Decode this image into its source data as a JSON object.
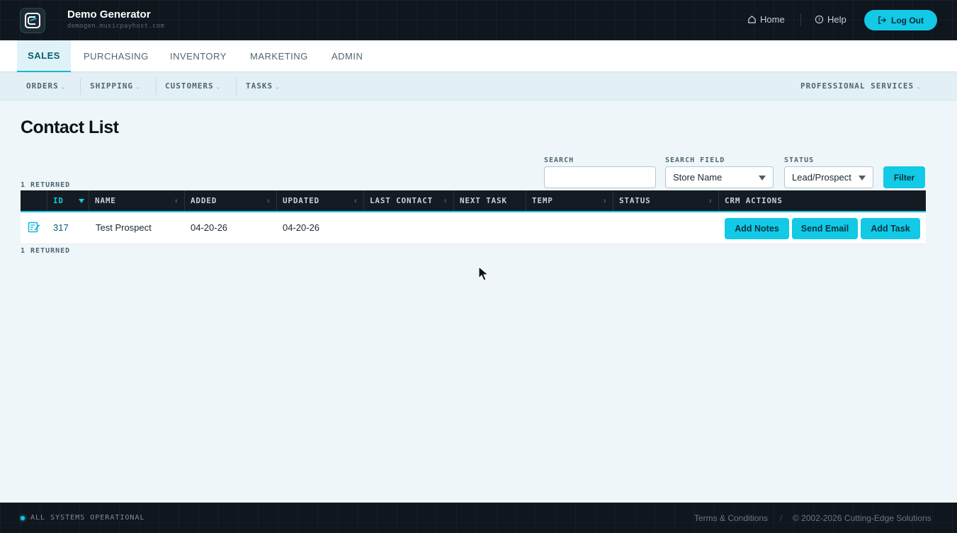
{
  "header": {
    "brand_name": "Demo Generator",
    "brand_host": "demogen.musicpayhost.com",
    "home_label": "Home",
    "help_label": "Help",
    "logout_label": "Log Out"
  },
  "tabs": [
    {
      "label": "SALES",
      "active": true
    },
    {
      "label": "PURCHASING",
      "active": false
    },
    {
      "label": "INVENTORY",
      "active": false
    },
    {
      "label": "MARKETING",
      "active": false
    },
    {
      "label": "ADMIN",
      "active": false
    }
  ],
  "subnav": {
    "items": [
      {
        "label": "ORDERS"
      },
      {
        "label": "SHIPPING"
      },
      {
        "label": "CUSTOMERS"
      },
      {
        "label": "TASKS"
      }
    ],
    "right_item": "PROFESSIONAL SERVICES"
  },
  "page": {
    "title": "Contact List",
    "returned_top": "1 RETURNED",
    "returned_bottom": "1 RETURNED"
  },
  "filters": {
    "search_label": "SEARCH",
    "search_value": "",
    "search_field_label": "SEARCH FIELD",
    "search_field_value": "Store Name",
    "status_label": "STATUS",
    "status_value": "Lead/Prospect",
    "filter_button": "Filter"
  },
  "table": {
    "columns": [
      "ID",
      "NAME",
      "ADDED",
      "UPDATED",
      "LAST CONTACT",
      "NEXT TASK",
      "TEMP",
      "STATUS",
      "CRM ACTIONS"
    ],
    "rows": [
      {
        "id": "317",
        "name": "Test Prospect",
        "added": "04-20-26",
        "updated": "04-20-26",
        "last_contact": "",
        "next_task": "",
        "temp": "",
        "status": "",
        "actions": [
          "Add Notes",
          "Send Email",
          "Add Task"
        ]
      }
    ]
  },
  "footer": {
    "status": "ALL SYSTEMS OPERATIONAL",
    "terms": "Terms & Conditions",
    "separator": "/",
    "copyright": "© 2002-2026 Cutting-Edge Solutions"
  },
  "colors": {
    "accent": "#12c9e6",
    "header_bg": "#0f161d",
    "page_bg": "#eff6f9"
  }
}
